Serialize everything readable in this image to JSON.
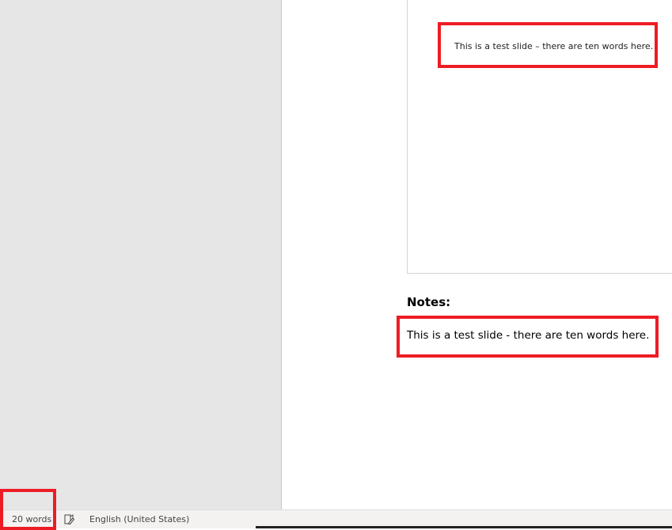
{
  "slide": {
    "text": "This is a test slide – there are ten words here."
  },
  "notes": {
    "label": "Notes:",
    "text": "This is a test slide - there are ten words here."
  },
  "status_bar": {
    "word_count": "20 words",
    "proofing_icon": "proofing-book-icon",
    "language": "English (United States)"
  },
  "colors": {
    "highlight": "#ed1c24",
    "panel": "#e6e6e6"
  }
}
